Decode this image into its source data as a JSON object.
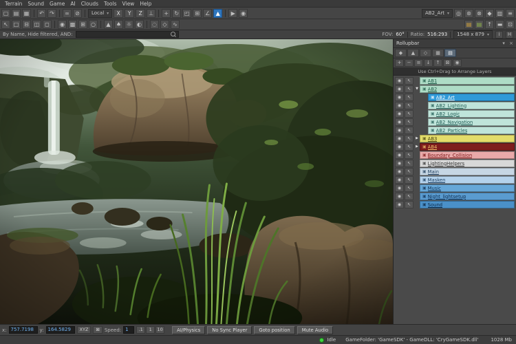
{
  "menu": {
    "items": [
      "Terrain",
      "Sound",
      "Game",
      "AI",
      "Clouds",
      "Tools",
      "View",
      "Help"
    ]
  },
  "toolbar_main": {
    "items": [
      {
        "t": "i",
        "n": "file-new-icon",
        "g": "▢"
      },
      {
        "t": "i",
        "n": "folder-open-icon",
        "g": "▤"
      },
      {
        "t": "i",
        "n": "save-level-icon",
        "g": "▦"
      },
      {
        "t": "s"
      },
      {
        "t": "i",
        "n": "undo-icon",
        "g": "↶"
      },
      {
        "t": "i",
        "n": "redo-icon",
        "g": "↷"
      },
      {
        "t": "s"
      },
      {
        "t": "i",
        "n": "link-objects-icon",
        "g": "∞"
      },
      {
        "t": "i",
        "n": "unlink-objects-icon",
        "g": "⊘"
      },
      {
        "t": "s"
      },
      {
        "t": "d",
        "n": "coord-system-dropdown",
        "label": "Local"
      },
      {
        "t": "b",
        "n": "axis-x-button",
        "label": "X"
      },
      {
        "t": "b",
        "n": "axis-y-button",
        "label": "Y"
      },
      {
        "t": "b",
        "n": "axis-z-button",
        "label": "Z"
      },
      {
        "t": "i",
        "n": "axis-terrain-icon",
        "g": "⊥"
      },
      {
        "t": "s"
      },
      {
        "t": "i",
        "n": "move-tool-icon",
        "g": "+"
      },
      {
        "t": "i",
        "n": "rotate-tool-icon",
        "g": "↻"
      },
      {
        "t": "i",
        "n": "scale-tool-icon",
        "g": "◰"
      },
      {
        "t": "i",
        "n": "snap-grid-icon",
        "g": "⊞"
      },
      {
        "t": "i",
        "n": "snap-angle-icon",
        "g": "∠"
      },
      {
        "t": "i",
        "n": "follow-terrain-icon",
        "g": "▲",
        "sel": true
      },
      {
        "t": "s"
      },
      {
        "t": "i",
        "n": "simulate-physics-icon",
        "g": "▶"
      },
      {
        "t": "i",
        "n": "camera-icon",
        "g": "◉"
      },
      {
        "t": "sp"
      },
      {
        "t": "d",
        "n": "current-layer-dropdown",
        "label": "AB2_Art"
      },
      {
        "t": "i",
        "n": "goto-selection-icon",
        "g": "◎"
      },
      {
        "t": "i",
        "n": "freeze-selection-icon",
        "g": "⊛"
      },
      {
        "t": "i",
        "n": "hide-selection-icon",
        "g": "⊗"
      },
      {
        "t": "i",
        "n": "material-editor-icon",
        "g": "◆"
      },
      {
        "t": "i",
        "n": "database-view-icon",
        "g": "▥"
      },
      {
        "t": "i",
        "n": "preferences-icon",
        "g": "≡"
      }
    ]
  },
  "toolbar_view": {
    "items": [
      {
        "t": "i",
        "n": "pointer-select-icon",
        "g": "↖"
      },
      {
        "t": "i",
        "n": "select-all-icon",
        "g": "□"
      },
      {
        "t": "i",
        "n": "deselect-all-icon",
        "g": "⊟"
      },
      {
        "t": "i",
        "n": "hide-objects-icon",
        "g": "◫"
      },
      {
        "t": "i",
        "n": "unhide-all-icon",
        "g": "◻"
      },
      {
        "t": "s"
      },
      {
        "t": "i",
        "n": "default-camera-icon",
        "g": "◉"
      },
      {
        "t": "i",
        "n": "wireframe-toggle-icon",
        "g": "▩"
      },
      {
        "t": "i",
        "n": "grid-toggle-icon",
        "g": "⊞"
      },
      {
        "t": "i",
        "n": "helpers-toggle-icon",
        "g": "○"
      },
      {
        "t": "s"
      },
      {
        "t": "i",
        "n": "terrain-tool-icon",
        "g": "▲"
      },
      {
        "t": "i",
        "n": "vegetation-tool-icon",
        "g": "♠"
      },
      {
        "t": "i",
        "n": "sun-settings-icon",
        "g": "☼"
      },
      {
        "t": "i",
        "n": "time-of-day-icon",
        "g": "◐"
      },
      {
        "t": "s"
      },
      {
        "t": "i",
        "n": "ai-debug-icon",
        "g": "◌"
      },
      {
        "t": "i",
        "n": "flowgraph-icon",
        "g": "◇"
      },
      {
        "t": "i",
        "n": "trackview-icon",
        "g": "∿"
      },
      {
        "t": "sp"
      },
      {
        "t": "i",
        "n": "layers-folder-icon",
        "g": "▤",
        "c": "#d2a23a"
      },
      {
        "t": "i",
        "n": "assets-folder-icon",
        "g": "▤",
        "c": "#8fb44a"
      },
      {
        "t": "i",
        "n": "export-level-icon",
        "g": "↑"
      },
      {
        "t": "i",
        "n": "console-toggle-icon",
        "g": "▬"
      },
      {
        "t": "i",
        "n": "fullscreen-toggle-icon",
        "g": "⊡"
      }
    ]
  },
  "filter_bar": {
    "label": "By Name, Hide filtered, AND:",
    "search_value": "",
    "fov_label": "FOV:",
    "fov_value": "60°",
    "ratio_label": "Ratio:",
    "ratio_value": "516:293",
    "resolution": "1548 x 879",
    "info_button": "i",
    "help_button": "H"
  },
  "rollupbar": {
    "title": "Rollupbar",
    "hint": "Use Ctrl+Drag to Arrange Layers",
    "eye_glyph": "◉",
    "pointer_glyph": "↖",
    "layer_icon_glyph": "▣",
    "tabs": [
      {
        "n": "tab-objects",
        "g": "◆"
      },
      {
        "n": "tab-terrain",
        "g": "▲"
      },
      {
        "n": "tab-modelling",
        "g": "◇"
      },
      {
        "n": "tab-display",
        "g": "▦"
      },
      {
        "n": "tab-layers",
        "g": "▤",
        "sel": true
      }
    ],
    "tools": [
      {
        "n": "new-layer-icon",
        "g": "+"
      },
      {
        "n": "delete-layer-icon",
        "g": "−"
      },
      {
        "n": "rename-layer-icon",
        "g": "≡"
      },
      {
        "n": "import-layer-icon",
        "g": "↓"
      },
      {
        "n": "export-layer-icon",
        "g": "↑"
      },
      {
        "n": "freeze-all-icon",
        "g": "⊠"
      },
      {
        "n": "visibility-all-icon",
        "g": "◉"
      }
    ],
    "layers": [
      {
        "name": "AB1",
        "bg": "#aedcc6",
        "fg": "#1d5a46",
        "exp": "",
        "indent": 0
      },
      {
        "name": "AB2",
        "bg": "#aedcc6",
        "fg": "#1d5a46",
        "exp": "▼",
        "indent": 0
      },
      {
        "name": "AB2_Art",
        "bg": "#2f9ad8",
        "fg": "#ffffff",
        "exp": "",
        "indent": 1,
        "sel": true
      },
      {
        "name": "AB2_Lighting",
        "bg": "#bfe4da",
        "fg": "#1d5a52",
        "exp": "",
        "indent": 1
      },
      {
        "name": "AB2_Logic",
        "bg": "#bfe4da",
        "fg": "#1d5a52",
        "exp": "",
        "indent": 1
      },
      {
        "name": "AB2_Navigation",
        "bg": "#bfe4da",
        "fg": "#1d5a52",
        "exp": "",
        "indent": 1
      },
      {
        "name": "AB2_Particles",
        "bg": "#bfe4da",
        "fg": "#1d5a52",
        "exp": "",
        "indent": 1
      },
      {
        "name": "AB3",
        "bg": "#e3dc6a",
        "fg": "#4a4310",
        "exp": "▶",
        "indent": 0
      },
      {
        "name": "AB4",
        "bg": "#7e1d1d",
        "fg": "#f2c26a",
        "exp": "▶",
        "indent": 0
      },
      {
        "name": "Boundary_Collision",
        "bg": "#e9a9a9",
        "fg": "#7c1616",
        "exp": "",
        "indent": 0
      },
      {
        "name": "LightingHelpers",
        "bg": "#d8d8d8",
        "fg": "#333333",
        "exp": "",
        "indent": 0
      },
      {
        "name": "Main",
        "bg": "#c6d6e4",
        "fg": "#1e3c5c",
        "exp": "",
        "indent": 0
      },
      {
        "name": "Masken",
        "bg": "#b4d2ec",
        "fg": "#173a5e",
        "exp": "",
        "indent": 0
      },
      {
        "name": "Music",
        "bg": "#66a7d8",
        "fg": "#0d2c4e",
        "exp": "",
        "indent": 0
      },
      {
        "name": "Night_lightsetup",
        "bg": "#5a9bd0",
        "fg": "#0d2c4e",
        "exp": "",
        "indent": 0
      },
      {
        "name": "Sound",
        "bg": "#4a90c8",
        "fg": "#0a2442",
        "exp": "",
        "indent": 0
      }
    ]
  },
  "bottom": {
    "x_label": "x:",
    "x_value": "757.7198",
    "y_label": "y:",
    "y_value": "164.5829",
    "xyz_label": "XYZ",
    "lock_glyph": "⊠",
    "speed_label": "Speed:",
    "speed_value": "1",
    "speed_presets": [
      {
        "n": "speed-point1-button",
        "label": ".1"
      },
      {
        "n": "speed-1-button",
        "label": "1"
      },
      {
        "n": "speed-10-button",
        "label": "10"
      }
    ],
    "buttons": [
      {
        "n": "ai-physics-button",
        "label": "AI/Physics"
      },
      {
        "n": "no-sync-player-button",
        "label": "No Sync Player"
      },
      {
        "n": "goto-position-button",
        "label": "Goto position"
      },
      {
        "n": "mute-audio-button",
        "label": "Mute Audio"
      }
    ]
  },
  "status": {
    "state": "Idle",
    "message": "GameFolder: 'GameSDK' - GameDLL: 'CryGameSDK.dll'",
    "memory": "1028 Mb"
  }
}
